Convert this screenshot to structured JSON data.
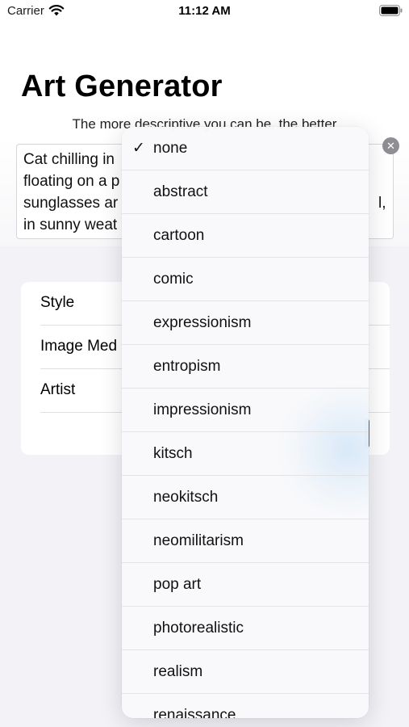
{
  "status_bar": {
    "carrier": "Carrier",
    "time": "11:12 AM",
    "icons": [
      "wifi-icon",
      "battery-icon"
    ]
  },
  "header": {
    "title": "Art Generator",
    "subtitle": "The more descriptive you can be, the better"
  },
  "prompt": {
    "lines": [
      "Cat chilling in",
      "floating on a p",
      "sunglasses ar",
      "in sunny weat"
    ],
    "right_fragments": [
      "l,"
    ],
    "clear_icon": "clear-circle-icon"
  },
  "settings": {
    "rows": [
      {
        "label": "Style"
      },
      {
        "label": "Image Med"
      },
      {
        "label": "Artist"
      },
      {
        "label": ""
      }
    ],
    "accent_color": "#0a7aff"
  },
  "style_menu": {
    "selected": "none",
    "items": [
      "none",
      "abstract",
      "cartoon",
      "comic",
      "expressionism",
      "entropism",
      "impressionism",
      "kitsch",
      "neokitsch",
      "neomilitarism",
      "pop art",
      "photorealistic",
      "realism",
      "renaissance"
    ]
  }
}
